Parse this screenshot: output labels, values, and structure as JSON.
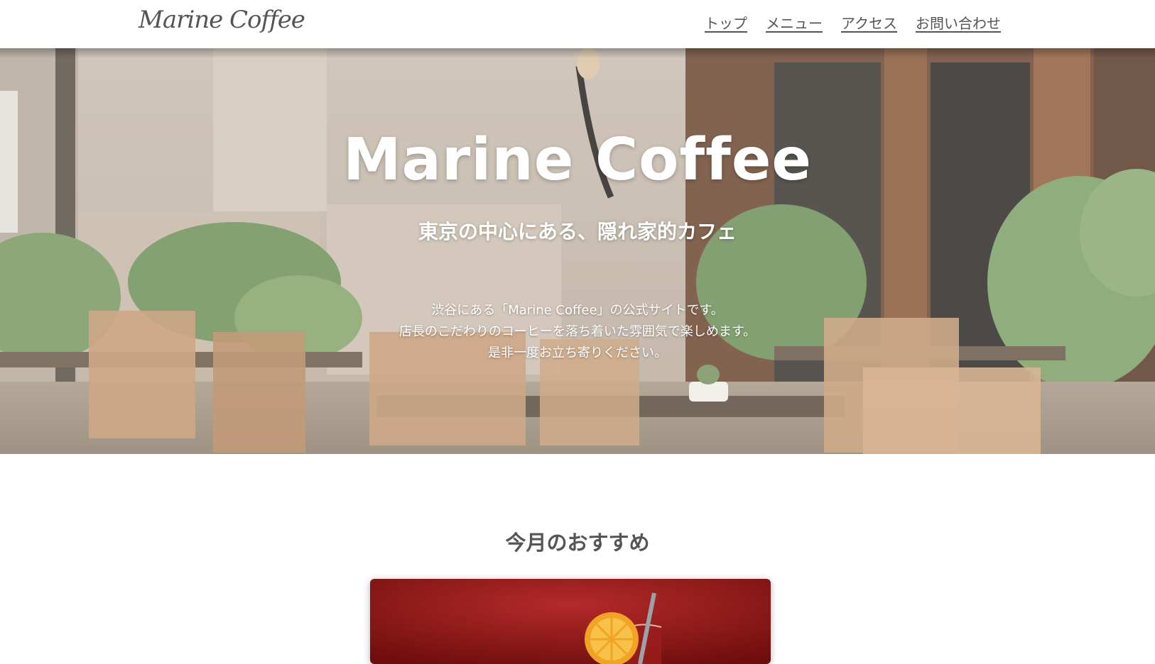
{
  "header": {
    "logo": "Marine Coffee",
    "nav": [
      "トップ",
      "メニュー",
      "アクセス",
      "お問い合わせ"
    ]
  },
  "hero": {
    "title": "Marine Coffee",
    "subtitle": "東京の中心にある、隠れ家的カフェ",
    "description": [
      "渋谷にある「Marine Coffee」の公式サイトです。",
      "店長のこだわりのコーヒーを落ち着いた雰囲気で楽しめます。",
      "是非一度お立ち寄りください。"
    ]
  },
  "recommend": {
    "title": "今月のおすすめ"
  },
  "colors": {
    "text": "#555555",
    "background": "#ffffff",
    "card_red": "#8e1414"
  }
}
